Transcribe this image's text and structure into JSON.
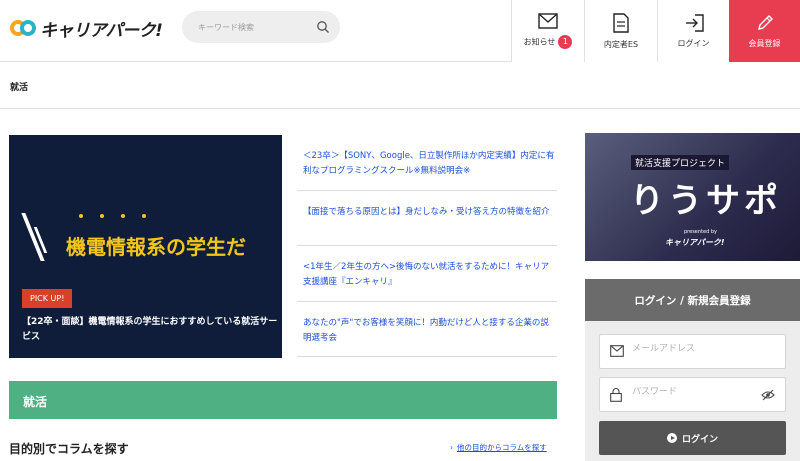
{
  "header": {
    "logo_text": "キャリアパーク!",
    "search_placeholder": "キーワード検索",
    "nav": {
      "notice_label": "お知らせ",
      "notice_count": "1",
      "es_label": "内定者ES",
      "login_label": "ログイン",
      "register_label": "会員登録"
    }
  },
  "breadcrumb": {
    "current": "就活"
  },
  "hero": {
    "headline": "機電情報系の学生だ",
    "tag": "PICK UP!",
    "caption": "【22卒・面談】機電情報系の学生におすすめしている就活サービス"
  },
  "news": [
    {
      "text": "＜23卒＞【SONY、Google、日立製作所ほか内定実績】内定に有利なプログラミングスクール※無料説明会※"
    },
    {
      "text": "【面接で落ちる原因とは】身だしなみ・受け答え方の特徴を紹介"
    },
    {
      "text": "<1年生／2年生の方へ>後悔のない就活をするために！キャリア支援講座『エンキャリ』"
    },
    {
      "text": "あなたの\"声\"でお客様を笑顔に！内勤だけど人と接する企業の説明選考会"
    }
  ],
  "section": {
    "title": "就活",
    "column_title": "目的別でコラムを探す",
    "column_link": "他の目的からコラムを探す"
  },
  "sidebar": {
    "banner_sub": "就活支援プロジェクト",
    "banner_main": "りうサポ",
    "banner_presented": "presented by",
    "banner_logo": "キャリアパーク!",
    "login_heading": "ログイン / 新規会員登録",
    "email_placeholder": "メールアドレス",
    "password_placeholder": "パスワード",
    "login_button": "ログイン"
  },
  "colors": {
    "accent_red": "#e83c50",
    "section_green": "#4fb083",
    "link_blue": "#1d4fd8",
    "hero_yellow": "#f5c518"
  },
  "icons": [
    "search-icon",
    "envelope-icon",
    "document-icon",
    "login-arrow-icon",
    "pencil-icon",
    "mail-icon",
    "lock-icon",
    "eye-slash-icon"
  ]
}
